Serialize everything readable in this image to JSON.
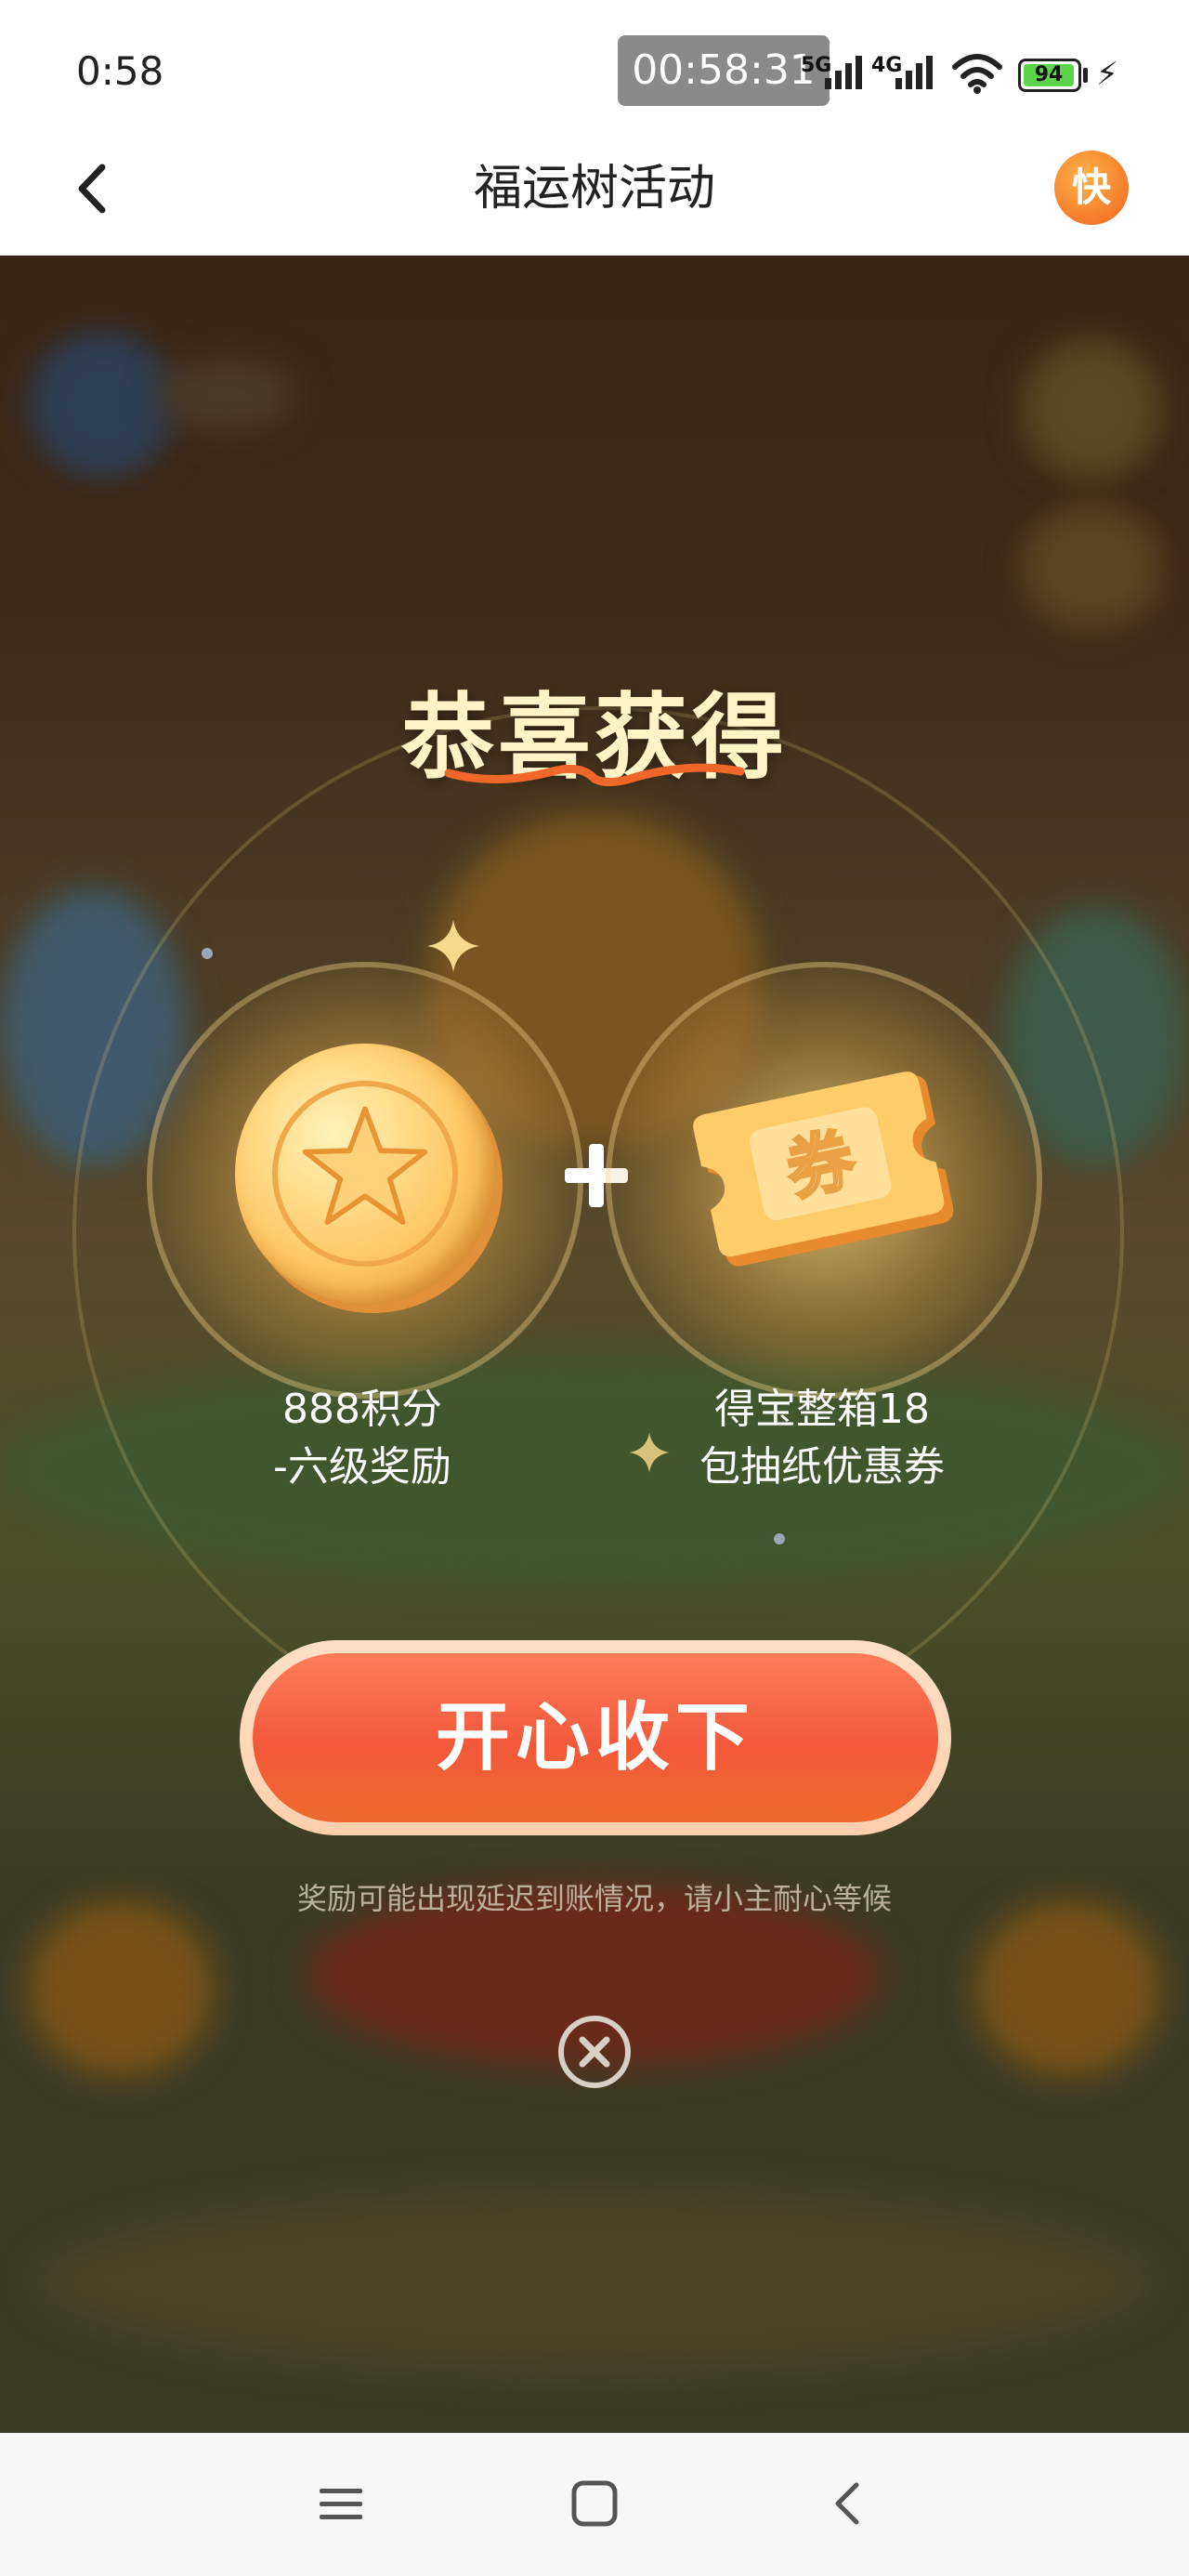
{
  "status_bar": {
    "time": "0:58",
    "recording_time": "00:58:31",
    "network_1": "5G",
    "network_2": "4G",
    "battery": "94"
  },
  "header": {
    "title": "福运树活动",
    "app_badge": "快"
  },
  "dialog": {
    "heading": "恭喜获得",
    "reward_1": {
      "line1": "888积分",
      "line2": "-六级奖励",
      "icon": "star-coin-icon"
    },
    "plus": "+",
    "reward_2": {
      "line1": "得宝整箱18",
      "line2": "包抽纸优惠券",
      "icon": "coupon-ticket-icon",
      "ticket_text": "券"
    },
    "accept_button": "开心收下",
    "notice": "奖励可能出现延迟到账情况，请小主耐心等候"
  },
  "colors": {
    "button": "#f2583a",
    "heading": "#fff4c8",
    "coin": "#ffc864"
  }
}
